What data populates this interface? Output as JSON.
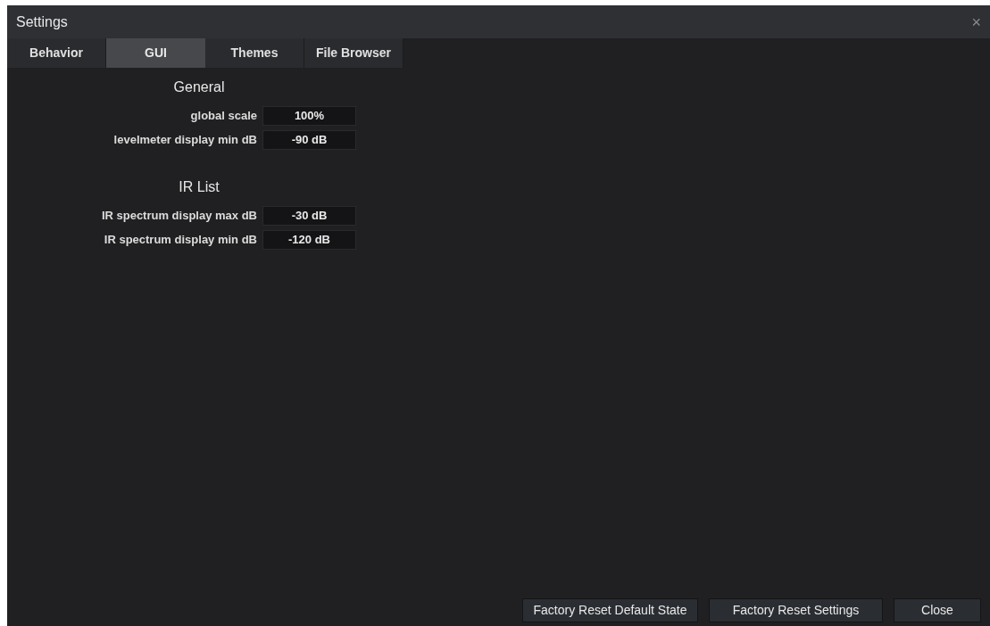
{
  "window": {
    "title": "Settings",
    "close": "×"
  },
  "tabs": [
    {
      "label": "Behavior",
      "selected": false
    },
    {
      "label": "GUI",
      "selected": true
    },
    {
      "label": "Themes",
      "selected": false
    },
    {
      "label": "File Browser",
      "selected": false
    }
  ],
  "sections": [
    {
      "heading": "General",
      "settings": [
        {
          "label": "global scale",
          "value": "100%"
        },
        {
          "label": "levelmeter display min dB",
          "value": "-90 dB"
        }
      ]
    },
    {
      "heading": "IR List",
      "settings": [
        {
          "label": "IR spectrum display max dB",
          "value": "-30 dB"
        },
        {
          "label": "IR spectrum display min dB",
          "value": "-120 dB"
        }
      ]
    }
  ],
  "buttons": [
    "Factory Reset Default State",
    "Factory Reset Settings",
    "Close"
  ]
}
